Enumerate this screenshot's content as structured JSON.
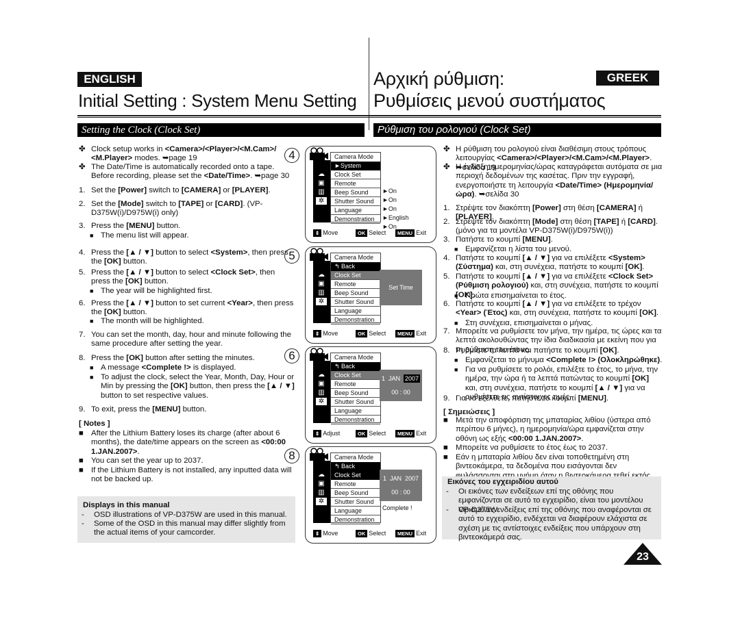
{
  "header": {
    "english_badge": "ENGLISH",
    "greek_badge": "GREEK",
    "english_title": "Initial Setting : System Menu Setting",
    "greek_title_1": "Αρχική ρύθμιση:",
    "greek_title_2": "Ρυθμίσεις μενού συστήματος"
  },
  "english": {
    "section": "Setting the Clock (Clock Set)",
    "items": [
      {
        "mk": "✤",
        "seg": [
          "Clock setup works in ",
          "<Camera>/<Player>/<M.Cam>/ <M.Player>",
          " modes. ➥page 19"
        ]
      },
      {
        "mk": "✤",
        "seg": [
          "The Date/Time is automatically recorded onto a tape. Before recording, please set the ",
          "<Date/Time>",
          ". ➥page 30"
        ]
      },
      {
        "mk": "1.",
        "seg": [
          "Set the ",
          "[Power]",
          " switch to ",
          "[CAMERA]",
          " or ",
          "[PLAYER]",
          "."
        ]
      },
      {
        "mk": "2.",
        "seg": [
          "Set the ",
          "[Mode]",
          " switch to ",
          "[TAPE]",
          " or ",
          "[CARD]",
          ". (VP-D375W(i)/D975W(i) only)"
        ]
      },
      {
        "mk": "3.",
        "seg": [
          "Press the ",
          "[MENU]",
          " button."
        ]
      },
      {
        "mk": "■",
        "sub": true,
        "seg": [
          "The menu list will appear."
        ]
      },
      {
        "mk": "4.",
        "seg": [
          "Press the ",
          "[▲ / ▼]",
          " button to select ",
          "<System>",
          ", then press the ",
          "[OK]",
          " button."
        ]
      },
      {
        "mk": "5.",
        "seg": [
          "Press the ",
          "[▲ / ▼]",
          " button to select ",
          "<Clock Set>",
          ", then press the ",
          "[OK]",
          " button."
        ]
      },
      {
        "mk": "■",
        "sub": true,
        "seg": [
          "The year will be highlighted first."
        ]
      },
      {
        "mk": "6.",
        "seg": [
          "Press the ",
          "[▲ / ▼]",
          " button to set current ",
          "<Year>",
          ", then press the ",
          "[OK]",
          " button."
        ]
      },
      {
        "mk": "■",
        "sub": true,
        "seg": [
          "The month will be highlighted."
        ]
      },
      {
        "mk": "7.",
        "seg": [
          "You can set the month, day, hour and minute following the same procedure after setting the year."
        ]
      },
      {
        "mk": "8.",
        "seg": [
          "Press the ",
          "[OK]",
          " button after setting the minutes."
        ]
      },
      {
        "mk": "■",
        "sub": true,
        "seg": [
          "A message ",
          "<Complete !>",
          " is displayed."
        ]
      },
      {
        "mk": "■",
        "sub": true,
        "seg": [
          "To adjust the clock, select the Year, Month, Day, Hour or Min by pressing the ",
          "[OK]",
          " button, then press the ",
          "[▲ / ▼]",
          " button to set respective values."
        ]
      },
      {
        "mk": "9.",
        "seg": [
          "To exit, press the ",
          "[MENU]",
          " button."
        ]
      }
    ],
    "notes_title": "[ Notes ]",
    "notes": [
      {
        "mk": "■",
        "seg": [
          "After the Lithium Battery loses its charge (after about 6 months), the date/time appears on the screen as ",
          "<00:00 1.JAN.2007>",
          "."
        ]
      },
      {
        "mk": "■",
        "seg": [
          "You can set the year up to 2037."
        ]
      },
      {
        "mk": "■",
        "seg": [
          "If the Lithium Battery is not installed, any inputted data will not be backed up."
        ]
      }
    ],
    "box_title": "Displays in this manual",
    "box_items": [
      {
        "mk": "-",
        "seg": [
          "OSD illustrations of VP-D375W are used in this manual."
        ]
      },
      {
        "mk": "-",
        "seg": [
          "Some of the OSD in this manual may differ slightly from the actual items of your camcorder."
        ]
      }
    ]
  },
  "greek": {
    "section": "Ρύθμιση του ρολογιού (Clock Set)",
    "items": [
      {
        "mk": "✤",
        "seg": [
          "Η ρύθμιση του ρολογιού είναι διαθέσιμη στους τρόπους λειτουργίας ",
          "<Camera>/<Player>/<M.Cam>/<M.Player>",
          ". ➥σελίδα 19"
        ]
      },
      {
        "mk": "✤",
        "seg": [
          "Η ένδειξη ημερομηνίας/ώρας καταγράφεται αυτόματα σε μια περιοχή δεδομένων της κασέτας. Πριν την εγγραφή, ενεργοποιήστε τη λειτουργία ",
          "<Date/Time> (Ημερομηνία/ώρα)",
          ". ➥σελίδα 30"
        ]
      },
      {
        "mk": "1.",
        "seg": [
          "Στρέψτε τον διακόπτη ",
          "[Power]",
          " στη θέση ",
          "[CAMERA]",
          " ή ",
          "[PLAYER]",
          "."
        ]
      },
      {
        "mk": "2.",
        "seg": [
          "Στρέψτε τον διακόπτη ",
          "[Mode]",
          " στη θέση ",
          "[TAPE]",
          " ή ",
          "[CARD]",
          ". (μόνο για τα μοντέλα VP-D375W(i)/D975W(i))"
        ]
      },
      {
        "mk": "3.",
        "seg": [
          "Πατήστε το κουμπί ",
          "[MENU]",
          "."
        ]
      },
      {
        "mk": "■",
        "sub": true,
        "seg": [
          "Εμφανίζεται η λίστα του μενού."
        ]
      },
      {
        "mk": "4.",
        "seg": [
          "Πατήστε το κουμπί ",
          "[▲ / ▼]",
          " για να επιλέξετε ",
          "<System> (Σύστημα)",
          " και, στη συνέχεια, πατήστε το κουμπί ",
          "[OK]",
          "."
        ]
      },
      {
        "mk": "5.",
        "seg": [
          "Πατήστε το κουμπί ",
          "[▲ / ▼]",
          " για να επιλέξετε ",
          "<Clock Set> (Ρύθμιση ρολογιού)",
          " και, στη συνέχεια, πατήστε το κουμπί ",
          "[OK]",
          "."
        ]
      },
      {
        "mk": "■",
        "sub": true,
        "seg": [
          "Πρώτα επισημαίνεται το έτος."
        ]
      },
      {
        "mk": "6.",
        "seg": [
          "Πατήστε το κουμπί ",
          "[▲ / ▼]",
          " για να επιλέξετε το τρέχον ",
          "<Year> (Έτος)",
          " και, στη συνέχεια, πατήστε το κουμπί ",
          "[OK]",
          "."
        ]
      },
      {
        "mk": "■",
        "sub": true,
        "seg": [
          "Στη συνέχεια, επισημαίνεται ο μήνας."
        ]
      },
      {
        "mk": "7.",
        "seg": [
          "Μπορείτε να ρυθμίσετε τον μήνα, την ημέρα, τις ώρες και τα λεπτά ακολουθώντας την ίδια διαδικασία με εκείνη που για τη ρύθμιση του έτους."
        ]
      },
      {
        "mk": "8.",
        "seg": [
          "Ρυθμίστε τα λεπτά και πατήστε το κουμπί ",
          "[OK]",
          "."
        ]
      },
      {
        "mk": "■",
        "sub": true,
        "seg": [
          "Εμφανίζεται το μήνυμα ",
          "<Complete !> (Ολοκληρώθηκε)",
          "."
        ]
      },
      {
        "mk": "■",
        "sub": true,
        "seg": [
          "Για να ρυθμίσετε το ρολόι, επιλέξτε το έτος, το μήνα, την ημέρα, την ώρα ή τα λεπτά πατώντας το κουμπί ",
          "[OK]",
          " και, στη συνέχεια, πατήστε το κουμπί ",
          "[▲ / ▼]",
          " για να ρυθμίσετε τις αντίστοιχες τιμές."
        ]
      },
      {
        "mk": "9.",
        "seg": [
          "Για να εξέλθετε, πατήστε το κουμπί ",
          "[MENU]",
          "."
        ]
      }
    ],
    "notes_title": "[ Σημειώσεις ]",
    "notes": [
      {
        "mk": "■",
        "seg": [
          "Μετά την αποφόρτιση της μπαταρίας λιθίου (ύστερα από περίπου 6 μήνες), η ημερομηνία/ώρα εμφανίζεται στην οθόνη ως εξής ",
          "<00:00  1.JAN.2007>",
          "."
        ]
      },
      {
        "mk": "■",
        "seg": [
          "Μπορείτε να ρυθμίσετε το έτος έως το 2037."
        ]
      },
      {
        "mk": "■",
        "seg": [
          "Εάν η μπαταρία λιθίου δεν είναι τοποθετημένη στη βιντεοκάμερα, τα δεδομένα που εισάγονται δεν φυλάσσονται στη μνήμη όταν η βιντεοκάμερα τεθεί εκτός λειτουργίας."
        ]
      }
    ],
    "box_title": "Εικόνες του εγχειριδίου αυτού",
    "box_items": [
      {
        "mk": "-",
        "seg": [
          "Οι εικόνες των ενδείξεων επί της οθόνης που εμφανίζονται σε αυτό το εγχειρίδιο, είναι του μοντέλου VP-D375W."
        ]
      },
      {
        "mk": "-",
        "seg": [
          "Ορισμένες ενδείξεις επί της οθόνης που αναφέρονται σε αυτό το εγχειρίδιο, ενδέχεται να διαφέρουν ελάχιστα σε σχέση με τις αντίστοιχες ενδείξεις που υπάρχουν στη βιντεοκάμερά σας."
        ]
      }
    ]
  },
  "screens": [
    {
      "num": "4",
      "header": "Camera Mode",
      "row2": "►System",
      "items": [
        "Clock Set",
        "Remote",
        "Beep Sound",
        "Shutter Sound",
        "Language",
        "Demonstration"
      ],
      "values": [
        "",
        "►On",
        "►On",
        "►On",
        "►English",
        "►On"
      ],
      "move": "Move",
      "ok_key": "OK",
      "ok": "Select",
      "menu_key": "MENU",
      "exit": "Exit"
    },
    {
      "num": "5",
      "header": "Camera Mode",
      "row2": "↰ Back",
      "items": [
        "Clock Set",
        "Remote",
        "Beep Sound",
        "Shutter Sound",
        "Language",
        "Demonstration"
      ],
      "panel": "Set Time",
      "move": "Move",
      "ok_key": "OK",
      "ok": "Select",
      "menu_key": "MENU",
      "exit": "Exit"
    },
    {
      "num": "6",
      "header": "Camera Mode",
      "row2": "↰ Back",
      "items": [
        "Clock Set",
        "Remote",
        "Beep Sound",
        "Shutter Sound",
        "Language",
        "Demonstration"
      ],
      "day": "1",
      "month": "JAN",
      "year": "2007",
      "time": "00 : 00",
      "move": "Adjust",
      "ok_key": "OK",
      "ok": "Select",
      "menu_key": "MENU",
      "exit": "Exit"
    },
    {
      "num": "8",
      "header": "Camera Mode",
      "row2": "↰ Back",
      "items": [
        "Clock Set",
        "Remote",
        "Beep Sound",
        "Shutter Sound",
        "Language",
        "Demonstration"
      ],
      "day": "1",
      "month": "JAN",
      "year": "2007",
      "time": "00 : 00",
      "message": "Complete !",
      "move": "Move",
      "ok_key": "OK",
      "ok": "Select",
      "menu_key": "MENU",
      "exit": "Exit"
    }
  ],
  "page_number": "23"
}
